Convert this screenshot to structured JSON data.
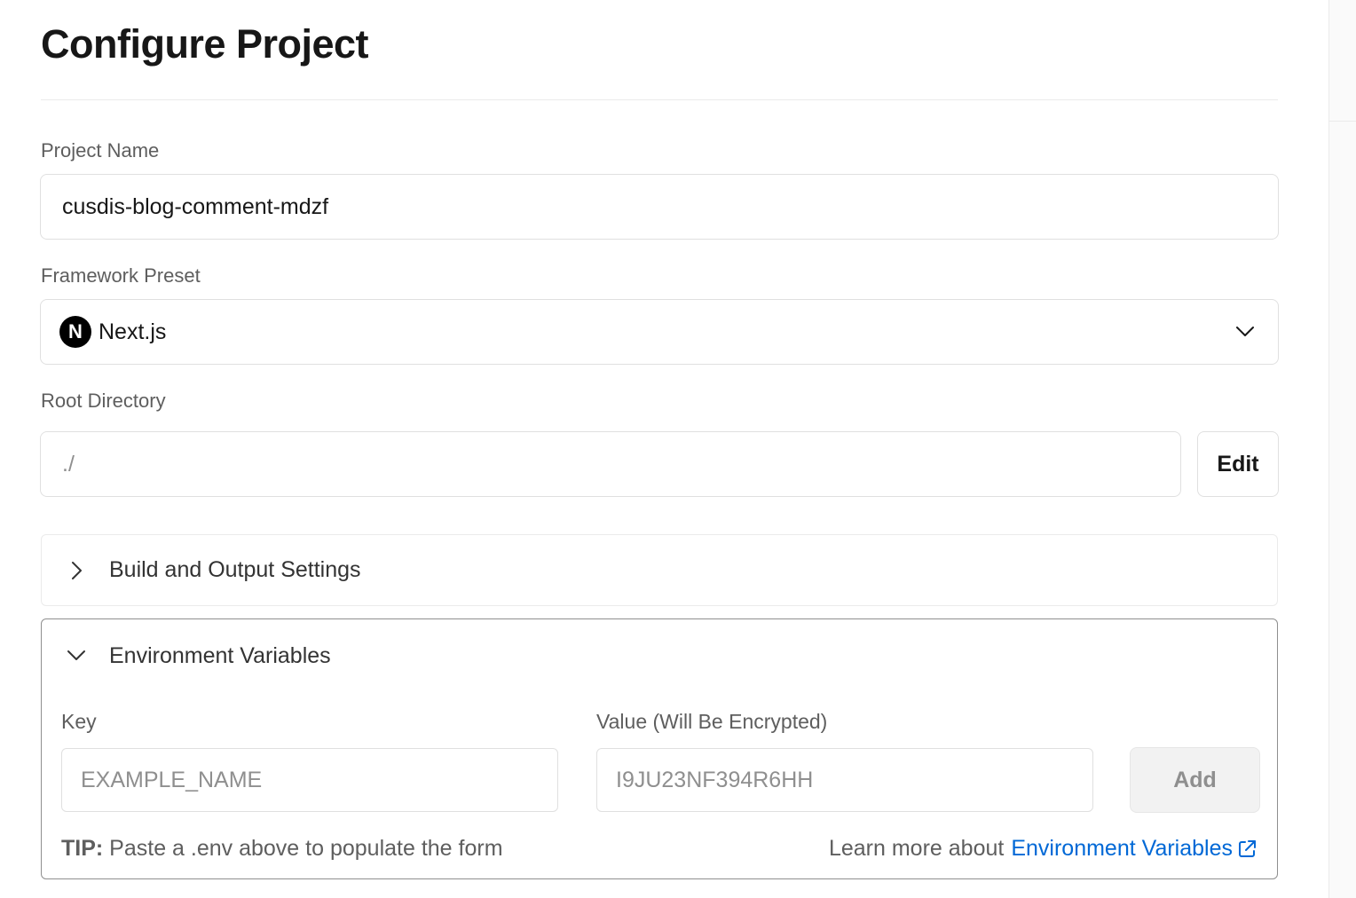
{
  "page": {
    "title": "Configure Project"
  },
  "project_name": {
    "label": "Project Name",
    "value": "cusdis-blog-comment-mdzf"
  },
  "framework": {
    "label": "Framework Preset",
    "logo_letter": "N",
    "value": "Next.js",
    "icon": "chevron-down-icon"
  },
  "root_directory": {
    "label": "Root Directory",
    "value": "./",
    "edit_label": "Edit"
  },
  "build_settings": {
    "title": "Build and Output Settings",
    "icon": "chevron-right-icon"
  },
  "env": {
    "title": "Environment Variables",
    "key_label": "Key",
    "key_placeholder": "EXAMPLE_NAME",
    "value_label": "Value (Will Be Encrypted)",
    "value_placeholder": "I9JU23NF394R6HH",
    "add_label": "Add",
    "tip_prefix": "TIP:",
    "tip_text": "Paste a .env above to populate the form",
    "learn_text": "Learn more about",
    "learn_link": "Environment Variables",
    "link_color": "#0068d6"
  }
}
